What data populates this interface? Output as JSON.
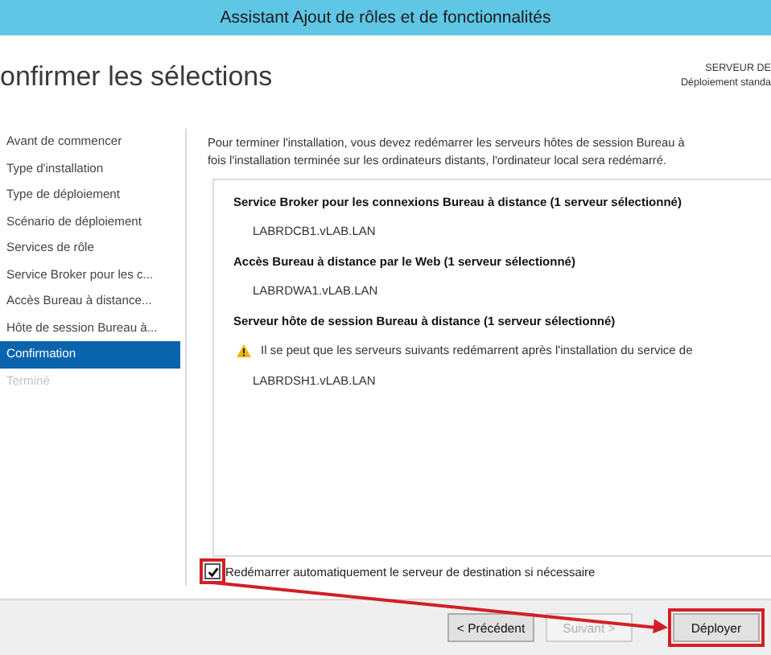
{
  "window": {
    "title": "Assistant Ajout de rôles et de fonctionnalités"
  },
  "header": {
    "title": "onfirmer les sélections",
    "server_lines": [
      "SERVEUR DE",
      "Déploiement standa"
    ]
  },
  "sidebar": {
    "items": [
      {
        "label": "Avant de commencer",
        "selected": false,
        "disabled": false
      },
      {
        "label": "Type d'installation",
        "selected": false,
        "disabled": false
      },
      {
        "label": "Type de déploiement",
        "selected": false,
        "disabled": false
      },
      {
        "label": "Scénario de déploiement",
        "selected": false,
        "disabled": false
      },
      {
        "label": "Services de rôle",
        "selected": false,
        "disabled": false
      },
      {
        "label": "Service Broker pour les c...",
        "selected": false,
        "disabled": false
      },
      {
        "label": "Accès Bureau à distance...",
        "selected": false,
        "disabled": false
      },
      {
        "label": "Hôte de session Bureau à...",
        "selected": false,
        "disabled": false
      },
      {
        "label": "Confirmation",
        "selected": true,
        "disabled": false
      },
      {
        "label": "Terminé",
        "selected": false,
        "disabled": true
      }
    ]
  },
  "content": {
    "intro": [
      "Pour terminer l'installation, vous devez redémarrer les serveurs hôtes de session Bureau à",
      "fois l'installation terminée sur les ordinateurs distants, l'ordinateur local sera redémarré."
    ],
    "items": [
      {
        "kind": "heading",
        "text": "Service Broker pour les connexions Bureau à distance  (1 serveur sélectionné)"
      },
      {
        "kind": "server",
        "text": "LABRDCB1.vLAB.LAN"
      },
      {
        "kind": "heading",
        "text": "Accès Bureau à distance par le Web  (1 serveur sélectionné)"
      },
      {
        "kind": "server",
        "text": "LABRDWA1.vLAB.LAN"
      },
      {
        "kind": "heading",
        "text": "Serveur hôte de session Bureau à distance  (1 serveur sélectionné)"
      },
      {
        "kind": "warning",
        "text": "Il se peut que les serveurs suivants redémarrent après l'installation du service de"
      },
      {
        "kind": "server",
        "text": "LABRDSH1.vLAB.LAN"
      }
    ]
  },
  "restart_option": {
    "label": "Redémarrer automatiquement le serveur de destination si nécessaire",
    "checked": true,
    "highlighted": true
  },
  "buttons": [
    {
      "label": "< Précédent",
      "disabled": false,
      "highlighted": false
    },
    {
      "label": "Suivant >",
      "disabled": true,
      "highlighted": false
    },
    {
      "label": "Déployer",
      "disabled": false,
      "highlighted": true
    }
  ]
}
